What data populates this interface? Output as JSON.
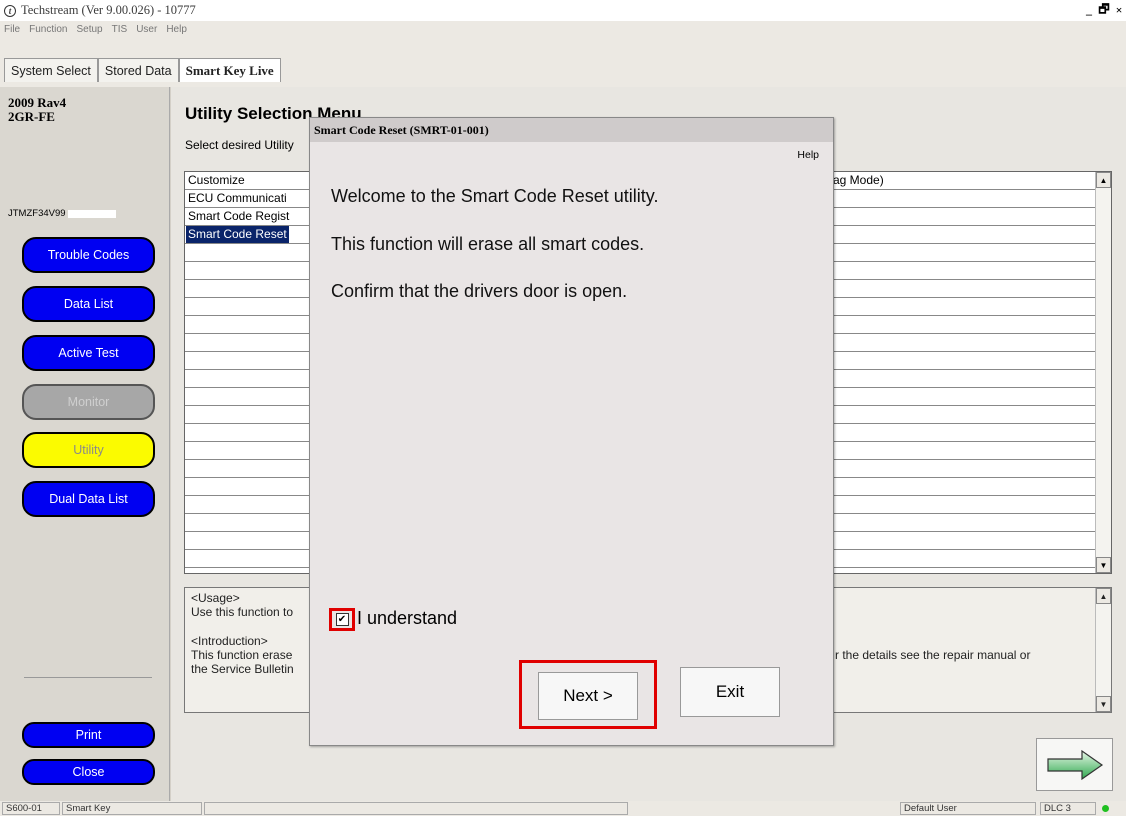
{
  "window": {
    "title": "Techstream (Ver 9.00.026) - 10777",
    "app_icon": "t-logo-icon",
    "controls": [
      "_",
      "▫",
      "×"
    ]
  },
  "menu": [
    "File",
    "Function",
    "Setup",
    "TIS",
    "User",
    "Help"
  ],
  "tabs": [
    {
      "label": "System Select",
      "active": false
    },
    {
      "label": "Stored Data",
      "active": false
    },
    {
      "label": "Smart Key Live",
      "active": true
    }
  ],
  "sidebar": {
    "vehicle_line1": "2009 Rav4",
    "vehicle_line2": "2GR-FE",
    "vin": "JTMZF34V99",
    "buttons": [
      {
        "label": "Trouble Codes",
        "state": "enabled"
      },
      {
        "label": "Data List",
        "state": "enabled"
      },
      {
        "label": "Active Test",
        "state": "enabled"
      },
      {
        "label": "Monitor",
        "state": "disabled"
      },
      {
        "label": "Utility",
        "state": "active"
      },
      {
        "label": "Dual Data List",
        "state": "enabled"
      }
    ],
    "print_label": "Print",
    "close_label": "Close"
  },
  "main": {
    "title": "Utility Selection Menu",
    "subtitle": "Select desired Utility",
    "list": [
      {
        "left": "Customize",
        "right": "ag Mode)"
      },
      {
        "left": "ECU Communicati",
        "right": ""
      },
      {
        "left": "Smart Code Regist",
        "right": ""
      },
      {
        "left": "Smart Code Reset",
        "right": "",
        "selected": true
      }
    ],
    "info": {
      "usage_heading": "<Usage>",
      "usage_text": "Use this function to",
      "intro_heading": "<Introduction>",
      "intro_line1": "This function erase",
      "intro_line2": "the Service Bulletin",
      "intro_right": "r the details see the repair manual or"
    },
    "next_arrow": "arrow-right-icon"
  },
  "dialog": {
    "title": "Smart Code Reset (SMRT-01-001)",
    "help": "Help",
    "messages": [
      "Welcome to the Smart Code Reset utility.",
      "This function will erase all smart codes.",
      "Confirm that the drivers door is open."
    ],
    "checkbox_label": "I understand",
    "checkbox_checked": true,
    "next_label": "Next >",
    "exit_label": "Exit"
  },
  "status": {
    "code": "S600-01",
    "system": "Smart Key",
    "user": "Default User",
    "connector": "DLC 3",
    "indicator_color": "#20c020"
  },
  "colors": {
    "button_blue": "#0000f2",
    "button_yellow": "#fbfb00",
    "highlight_red": "#e00000",
    "selection": "#0a246a"
  }
}
